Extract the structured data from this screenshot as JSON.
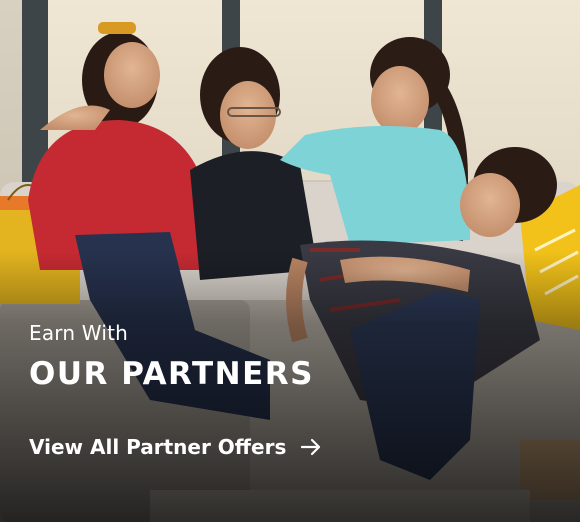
{
  "hero": {
    "eyebrow": "Earn With",
    "headline": "OUR PARTNERS",
    "cta_label": "View All Partner Offers",
    "cta_icon": "arrow-right-icon",
    "text_color": "#ffffff"
  },
  "palette": {
    "sofa": "#d9d3cb",
    "window_frame": "#3e4549",
    "shopping_bag": "#e3b41f",
    "cushion": "#f2c21a"
  }
}
